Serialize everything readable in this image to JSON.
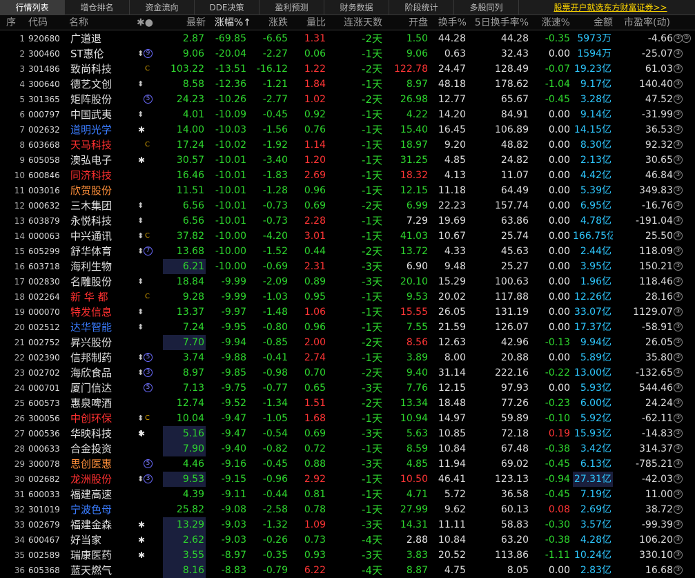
{
  "tabs": [
    "行情列表",
    "增仓排名",
    "资金流向",
    "DDE决策",
    "盈利预测",
    "财务数据",
    "阶段统计",
    "多股同列"
  ],
  "active_tab": 0,
  "promo_link": "股票开户就选东方财富证券>>",
  "columns": {
    "seq": "序",
    "code": "代码",
    "name": "名称",
    "marks": "✱●",
    "price": "最新",
    "chg_pct": "涨幅%↑",
    "chg": "涨跌",
    "vol_ratio": "量比",
    "streak": "连涨天数",
    "open": "开盘",
    "turnover": "换手%",
    "turnover5": "5日换手率%",
    "speed": "涨速%",
    "amount": "金额",
    "pe": "市盈率(动)",
    "pe_icon": "③"
  },
  "colors": {
    "up": "#ff3535",
    "down": "#2ed62e",
    "amount": "#2ec8ff",
    "highlight_bg": "#1a1f3d"
  },
  "rows": [
    {
      "seq": "1",
      "code": "920680",
      "name": "广道退",
      "nc": "white-n",
      "marks": "",
      "price": "2.87",
      "pc": "green",
      "chgp": "-69.85",
      "chg": "-6.65",
      "vr": "1.31",
      "vrc": "red",
      "days": "-2天",
      "open": "1.50",
      "oc": "green",
      "turn": "44.28",
      "t5": "44.28",
      "spd": "-0.35",
      "sc": "green",
      "amt": "5973万",
      "pe": "-4.66"
    },
    {
      "seq": "2",
      "code": "300460",
      "name": "ST惠伦",
      "nc": "white-n",
      "marks": "arrow,circle:9",
      "price": "9.06",
      "pc": "green",
      "chgp": "-20.04",
      "chg": "-2.27",
      "vr": "0.06",
      "vrc": "green",
      "days": "-1天",
      "open": "9.06",
      "oc": "green",
      "turn": "0.63",
      "t5": "32.43",
      "spd": "0.00",
      "sc": "white",
      "amt": "1594万",
      "pe": "-25.07"
    },
    {
      "seq": "3",
      "code": "301486",
      "name": "致尚科技",
      "nc": "white-n",
      "marks": "R,C",
      "price": "103.22",
      "pc": "green",
      "chgp": "-13.51",
      "chg": "-16.12",
      "vr": "1.22",
      "vrc": "red",
      "days": "-2天",
      "open": "122.78",
      "oc": "red",
      "turn": "24.47",
      "t5": "128.49",
      "spd": "-0.07",
      "sc": "green",
      "amt": "19.23亿",
      "pe": "61.03"
    },
    {
      "seq": "4",
      "code": "300640",
      "name": "德艺文创",
      "nc": "white-n",
      "marks": "arrow",
      "price": "8.58",
      "pc": "green",
      "chgp": "-12.36",
      "chg": "-1.21",
      "vr": "1.84",
      "vrc": "red",
      "days": "-1天",
      "open": "8.97",
      "oc": "green",
      "turn": "48.18",
      "t5": "178.62",
      "spd": "-1.04",
      "sc": "green",
      "amt": "9.17亿",
      "pe": "140.40"
    },
    {
      "seq": "5",
      "code": "301365",
      "name": "矩阵股份",
      "nc": "white-n",
      "marks": "R,circle:5",
      "price": "24.23",
      "pc": "green",
      "chgp": "-10.26",
      "chg": "-2.77",
      "vr": "1.02",
      "vrc": "red",
      "days": "-2天",
      "open": "26.98",
      "oc": "green",
      "turn": "12.77",
      "t5": "65.67",
      "spd": "-0.45",
      "sc": "green",
      "amt": "3.28亿",
      "pe": "47.52"
    },
    {
      "seq": "6",
      "code": "000797",
      "name": "中国武夷",
      "nc": "white-n",
      "marks": "arrow",
      "price": "4.01",
      "pc": "green",
      "chgp": "-10.09",
      "chg": "-0.45",
      "vr": "0.92",
      "vrc": "green",
      "days": "-1天",
      "open": "4.22",
      "oc": "green",
      "turn": "14.20",
      "t5": "84.91",
      "spd": "0.00",
      "sc": "white",
      "amt": "9.14亿",
      "pe": "-31.99"
    },
    {
      "seq": "7",
      "code": "002632",
      "name": "道明光学",
      "nc": "blue-n",
      "marks": "star",
      "price": "14.00",
      "pc": "green",
      "chgp": "-10.03",
      "chg": "-1.56",
      "vr": "0.76",
      "vrc": "green",
      "days": "-1天",
      "open": "15.40",
      "oc": "green",
      "turn": "16.45",
      "t5": "106.89",
      "spd": "0.00",
      "sc": "white",
      "amt": "14.15亿",
      "pe": "36.53"
    },
    {
      "seq": "8",
      "code": "603668",
      "name": "天马科技",
      "nc": "red-n",
      "marks": "R,C",
      "price": "17.24",
      "pc": "green",
      "chgp": "-10.02",
      "chg": "-1.92",
      "vr": "1.14",
      "vrc": "red",
      "days": "-1天",
      "open": "18.97",
      "oc": "green",
      "turn": "9.20",
      "t5": "48.82",
      "spd": "0.00",
      "sc": "white",
      "amt": "8.30亿",
      "pe": "92.32"
    },
    {
      "seq": "9",
      "code": "605058",
      "name": "澳弘电子",
      "nc": "white-n",
      "marks": "star",
      "price": "30.57",
      "pc": "green",
      "chgp": "-10.01",
      "chg": "-3.40",
      "vr": "1.20",
      "vrc": "red",
      "days": "-1天",
      "open": "31.25",
      "oc": "green",
      "turn": "4.85",
      "t5": "24.82",
      "spd": "0.00",
      "sc": "white",
      "amt": "2.13亿",
      "pe": "30.65"
    },
    {
      "seq": "10",
      "code": "600846",
      "name": "同济科技",
      "nc": "red-n",
      "marks": "R",
      "price": "16.46",
      "pc": "green",
      "chgp": "-10.01",
      "chg": "-1.83",
      "vr": "2.69",
      "vrc": "red",
      "days": "-1天",
      "open": "18.32",
      "oc": "red",
      "turn": "4.13",
      "t5": "11.07",
      "spd": "0.00",
      "sc": "white",
      "amt": "4.42亿",
      "pe": "46.84"
    },
    {
      "seq": "11",
      "code": "003016",
      "name": "欣贺股份",
      "nc": "orange-n",
      "marks": "",
      "price": "11.51",
      "pc": "green",
      "chgp": "-10.01",
      "chg": "-1.28",
      "vr": "0.96",
      "vrc": "green",
      "days": "-1天",
      "open": "12.15",
      "oc": "green",
      "turn": "11.18",
      "t5": "64.49",
      "spd": "0.00",
      "sc": "white",
      "amt": "5.39亿",
      "pe": "349.83"
    },
    {
      "seq": "12",
      "code": "000632",
      "name": "三木集团",
      "nc": "white-n",
      "marks": "arrow",
      "price": "6.56",
      "pc": "green",
      "chgp": "-10.01",
      "chg": "-0.73",
      "vr": "0.69",
      "vrc": "green",
      "days": "-2天",
      "open": "6.99",
      "oc": "green",
      "turn": "22.23",
      "t5": "157.74",
      "spd": "0.00",
      "sc": "white",
      "amt": "6.95亿",
      "pe": "-16.76"
    },
    {
      "seq": "13",
      "code": "603879",
      "name": "永悦科技",
      "nc": "white-n",
      "marks": "arrow",
      "price": "6.56",
      "pc": "green",
      "chgp": "-10.01",
      "chg": "-0.73",
      "vr": "2.28",
      "vrc": "red",
      "days": "-1天",
      "open": "7.29",
      "oc": "white",
      "turn": "19.69",
      "t5": "63.86",
      "spd": "0.00",
      "sc": "white",
      "amt": "4.78亿",
      "pe": "-191.04"
    },
    {
      "seq": "14",
      "code": "000063",
      "name": "中兴通讯",
      "nc": "white-n",
      "marks": "arrow,C",
      "price": "37.82",
      "pc": "green",
      "chgp": "-10.00",
      "chg": "-4.20",
      "vr": "3.01",
      "vrc": "red",
      "days": "-1天",
      "open": "41.03",
      "oc": "green",
      "turn": "10.67",
      "t5": "25.74",
      "spd": "0.00",
      "sc": "white",
      "amt": "166.75亿",
      "pe": "25.50"
    },
    {
      "seq": "15",
      "code": "605299",
      "name": "舒华体育",
      "nc": "white-n",
      "marks": "arrow,circle:7",
      "price": "13.68",
      "pc": "green",
      "chgp": "-10.00",
      "chg": "-1.52",
      "vr": "0.44",
      "vrc": "green",
      "days": "-2天",
      "open": "13.72",
      "oc": "green",
      "turn": "4.33",
      "t5": "45.63",
      "spd": "0.00",
      "sc": "white",
      "amt": "2.44亿",
      "pe": "118.09"
    },
    {
      "seq": "16",
      "code": "603718",
      "name": "海利生物",
      "nc": "white-n",
      "marks": "",
      "price": "6.21",
      "pc": "green",
      "phl": true,
      "chgp": "-10.00",
      "chg": "-0.69",
      "vr": "2.31",
      "vrc": "red",
      "days": "-3天",
      "open": "6.90",
      "oc": "white",
      "turn": "9.48",
      "t5": "25.27",
      "spd": "0.00",
      "sc": "white",
      "amt": "3.95亿",
      "pe": "150.21"
    },
    {
      "seq": "17",
      "code": "002830",
      "name": "名雕股份",
      "nc": "white-n",
      "marks": "arrow",
      "price": "18.84",
      "pc": "green",
      "chgp": "-9.99",
      "chg": "-2.09",
      "vr": "0.89",
      "vrc": "green",
      "days": "-3天",
      "open": "20.10",
      "oc": "green",
      "turn": "15.29",
      "t5": "100.63",
      "spd": "0.00",
      "sc": "white",
      "amt": "1.96亿",
      "pe": "118.46"
    },
    {
      "seq": "18",
      "code": "002264",
      "name": "新 华 都",
      "nc": "red-n",
      "marks": "C",
      "price": "9.28",
      "pc": "green",
      "chgp": "-9.99",
      "chg": "-1.03",
      "vr": "0.95",
      "vrc": "green",
      "days": "-1天",
      "open": "9.53",
      "oc": "green",
      "turn": "20.02",
      "t5": "117.88",
      "spd": "0.00",
      "sc": "white",
      "amt": "12.26亿",
      "pe": "28.16"
    },
    {
      "seq": "19",
      "code": "000070",
      "name": "特发信息",
      "nc": "red-n",
      "marks": "arrow",
      "price": "13.37",
      "pc": "green",
      "chgp": "-9.97",
      "chg": "-1.48",
      "vr": "1.06",
      "vrc": "red",
      "days": "-1天",
      "open": "15.55",
      "oc": "red",
      "turn": "26.05",
      "t5": "131.19",
      "spd": "0.00",
      "sc": "white",
      "amt": "33.07亿",
      "pe": "1129.07"
    },
    {
      "seq": "20",
      "code": "002512",
      "name": "达华智能",
      "nc": "blue-n",
      "marks": "arrow",
      "price": "7.24",
      "pc": "green",
      "chgp": "-9.95",
      "chg": "-0.80",
      "vr": "0.96",
      "vrc": "green",
      "days": "-1天",
      "open": "7.55",
      "oc": "green",
      "turn": "21.59",
      "t5": "126.07",
      "spd": "0.00",
      "sc": "white",
      "amt": "17.37亿",
      "pe": "-58.91"
    },
    {
      "seq": "21",
      "code": "002752",
      "name": "昇兴股份",
      "nc": "white-n",
      "marks": "",
      "price": "7.70",
      "pc": "green",
      "phl": true,
      "chgp": "-9.94",
      "chg": "-0.85",
      "vr": "2.00",
      "vrc": "red",
      "vhl": true,
      "days": "-2天",
      "open": "8.56",
      "oc": "red",
      "turn": "12.63",
      "t5": "42.96",
      "spd": "-0.13",
      "sc": "green",
      "amt": "9.94亿",
      "pe": "26.05"
    },
    {
      "seq": "22",
      "code": "002390",
      "name": "信邦制药",
      "nc": "white-n",
      "marks": "arrow,circle:5",
      "price": "3.74",
      "pc": "green",
      "chgp": "-9.88",
      "chg": "-0.41",
      "vr": "2.74",
      "vrc": "red",
      "days": "-1天",
      "open": "3.89",
      "oc": "green",
      "turn": "8.00",
      "t5": "20.88",
      "spd": "0.00",
      "sc": "white",
      "amt": "5.89亿",
      "pe": "35.80"
    },
    {
      "seq": "23",
      "code": "002702",
      "name": "海欣食品",
      "nc": "white-n",
      "marks": "arrow,circle:3",
      "price": "8.97",
      "pc": "green",
      "chgp": "-9.85",
      "chg": "-0.98",
      "vr": "0.70",
      "vrc": "green",
      "days": "-2天",
      "open": "9.40",
      "oc": "green",
      "turn": "31.14",
      "t5": "222.16",
      "spd": "-0.22",
      "sc": "green",
      "amt": "13.00亿",
      "pe": "-132.65"
    },
    {
      "seq": "24",
      "code": "000701",
      "name": "厦门信达",
      "nc": "white-n",
      "marks": "circle:5",
      "price": "7.13",
      "pc": "green",
      "chgp": "-9.75",
      "chg": "-0.77",
      "vr": "0.65",
      "vrc": "green",
      "days": "-3天",
      "open": "7.76",
      "oc": "green",
      "turn": "12.15",
      "t5": "97.93",
      "spd": "0.00",
      "sc": "white",
      "amt": "5.93亿",
      "pe": "544.46"
    },
    {
      "seq": "25",
      "code": "600573",
      "name": "惠泉啤酒",
      "nc": "white-n",
      "marks": "",
      "price": "12.74",
      "pc": "green",
      "chgp": "-9.52",
      "chg": "-1.34",
      "vr": "1.51",
      "vrc": "red",
      "days": "-2天",
      "open": "13.34",
      "oc": "green",
      "turn": "18.48",
      "t5": "77.26",
      "spd": "-0.23",
      "sc": "green",
      "amt": "6.00亿",
      "pe": "24.24"
    },
    {
      "seq": "26",
      "code": "300056",
      "name": "中创环保",
      "nc": "red-n",
      "marks": "arrow,C",
      "price": "10.04",
      "pc": "green",
      "chgp": "-9.47",
      "chg": "-1.05",
      "vr": "1.68",
      "vrc": "red",
      "days": "-1天",
      "open": "10.94",
      "oc": "green",
      "turn": "14.97",
      "t5": "59.89",
      "spd": "-0.10",
      "sc": "green",
      "amt": "5.92亿",
      "pe": "-62.11"
    },
    {
      "seq": "27",
      "code": "000536",
      "name": "华映科技",
      "nc": "white-n",
      "marks": "arrow,star",
      "price": "5.16",
      "pc": "green",
      "phl": true,
      "chgp": "-9.47",
      "chg": "-0.54",
      "vr": "0.69",
      "vrc": "green",
      "vhl": true,
      "days": "-3天",
      "open": "5.63",
      "oc": "green",
      "turn": "10.85",
      "t5": "72.18",
      "spd": "0.19",
      "sc": "red",
      "amt": "15.93亿",
      "pe": "-14.83"
    },
    {
      "seq": "28",
      "code": "000633",
      "name": "合金投资",
      "nc": "white-n",
      "marks": "",
      "price": "7.90",
      "pc": "green",
      "phl": true,
      "chgp": "-9.40",
      "chg": "-0.82",
      "vr": "0.72",
      "vrc": "green",
      "days": "-1天",
      "open": "8.59",
      "oc": "green",
      "turn": "10.84",
      "t5": "67.48",
      "spd": "-0.38",
      "sc": "green",
      "amt": "3.42亿",
      "pe": "314.37"
    },
    {
      "seq": "29",
      "code": "300078",
      "name": "思创医惠",
      "nc": "orange-n",
      "marks": "circle:5",
      "price": "4.46",
      "pc": "green",
      "chgp": "-9.16",
      "chg": "-0.45",
      "vr": "0.88",
      "vrc": "green",
      "days": "-3天",
      "open": "4.85",
      "oc": "green",
      "turn": "11.94",
      "t5": "69.02",
      "spd": "-0.45",
      "sc": "green",
      "amt": "6.13亿",
      "pe": "-785.21"
    },
    {
      "seq": "30",
      "code": "002682",
      "name": "龙洲股份",
      "nc": "red-n",
      "marks": "arrow,circle:3",
      "price": "9.53",
      "pc": "green",
      "phl": true,
      "chgp": "-9.15",
      "chg": "-0.96",
      "vr": "2.92",
      "vrc": "red",
      "days": "-1天",
      "open": "10.50",
      "oc": "red",
      "turn": "46.41",
      "t5": "123.13",
      "spd": "-0.94",
      "sc": "green",
      "amt": "27.31亿",
      "ahl": true,
      "pe": "-42.03"
    },
    {
      "seq": "31",
      "code": "600033",
      "name": "福建高速",
      "nc": "white-n",
      "marks": "",
      "price": "4.39",
      "pc": "green",
      "chgp": "-9.11",
      "chg": "-0.44",
      "vr": "0.81",
      "vrc": "green",
      "days": "-1天",
      "open": "4.71",
      "oc": "green",
      "turn": "5.72",
      "t5": "36.58",
      "spd": "-0.45",
      "sc": "green",
      "amt": "7.19亿",
      "pe": "11.00"
    },
    {
      "seq": "32",
      "code": "301019",
      "name": "宁波色母",
      "nc": "blue-n",
      "marks": "R",
      "price": "25.82",
      "pc": "green",
      "chgp": "-9.08",
      "chg": "-2.58",
      "vr": "0.78",
      "vrc": "green",
      "days": "-1天",
      "open": "27.99",
      "oc": "green",
      "turn": "9.62",
      "t5": "60.13",
      "spd": "0.08",
      "sc": "red",
      "amt": "2.69亿",
      "pe": "38.72"
    },
    {
      "seq": "33",
      "code": "002679",
      "name": "福建金森",
      "nc": "white-n",
      "marks": "star",
      "price": "13.29",
      "pc": "green",
      "phl": true,
      "chgp": "-9.03",
      "chg": "-1.32",
      "vr": "1.09",
      "vrc": "red",
      "days": "-3天",
      "open": "14.31",
      "oc": "green",
      "turn": "11.11",
      "t5": "58.83",
      "spd": "-0.30",
      "sc": "green",
      "amt": "3.57亿",
      "pe": "-99.39"
    },
    {
      "seq": "34",
      "code": "600467",
      "name": "好当家",
      "nc": "white-n",
      "marks": "star",
      "price": "2.62",
      "pc": "green",
      "phl": true,
      "chgp": "-9.03",
      "chg": "-0.26",
      "vr": "0.73",
      "vrc": "green",
      "vhl": true,
      "days": "-4天",
      "open": "2.88",
      "oc": "white",
      "turn": "10.84",
      "t5": "63.20",
      "spd": "-0.38",
      "sc": "green",
      "amt": "4.28亿",
      "pe": "106.20"
    },
    {
      "seq": "35",
      "code": "002589",
      "name": "瑞康医药",
      "nc": "white-n",
      "marks": "star",
      "price": "3.55",
      "pc": "green",
      "phl": true,
      "chgp": "-8.97",
      "chg": "-0.35",
      "vr": "0.93",
      "vrc": "green",
      "days": "-3天",
      "open": "3.83",
      "oc": "green",
      "turn": "20.52",
      "t5": "113.86",
      "spd": "-1.11",
      "sc": "green",
      "amt": "10.24亿",
      "pe": "330.10"
    },
    {
      "seq": "36",
      "code": "605368",
      "name": "蓝天燃气",
      "nc": "white-n",
      "marks": "",
      "price": "8.16",
      "pc": "green",
      "phl": true,
      "chgp": "-8.83",
      "chg": "-0.79",
      "vr": "6.22",
      "vrc": "red",
      "days": "-4天",
      "open": "8.87",
      "oc": "green",
      "turn": "4.75",
      "t5": "8.05",
      "spd": "0.00",
      "sc": "white",
      "amt": "2.83亿",
      "pe": "16.68"
    }
  ]
}
